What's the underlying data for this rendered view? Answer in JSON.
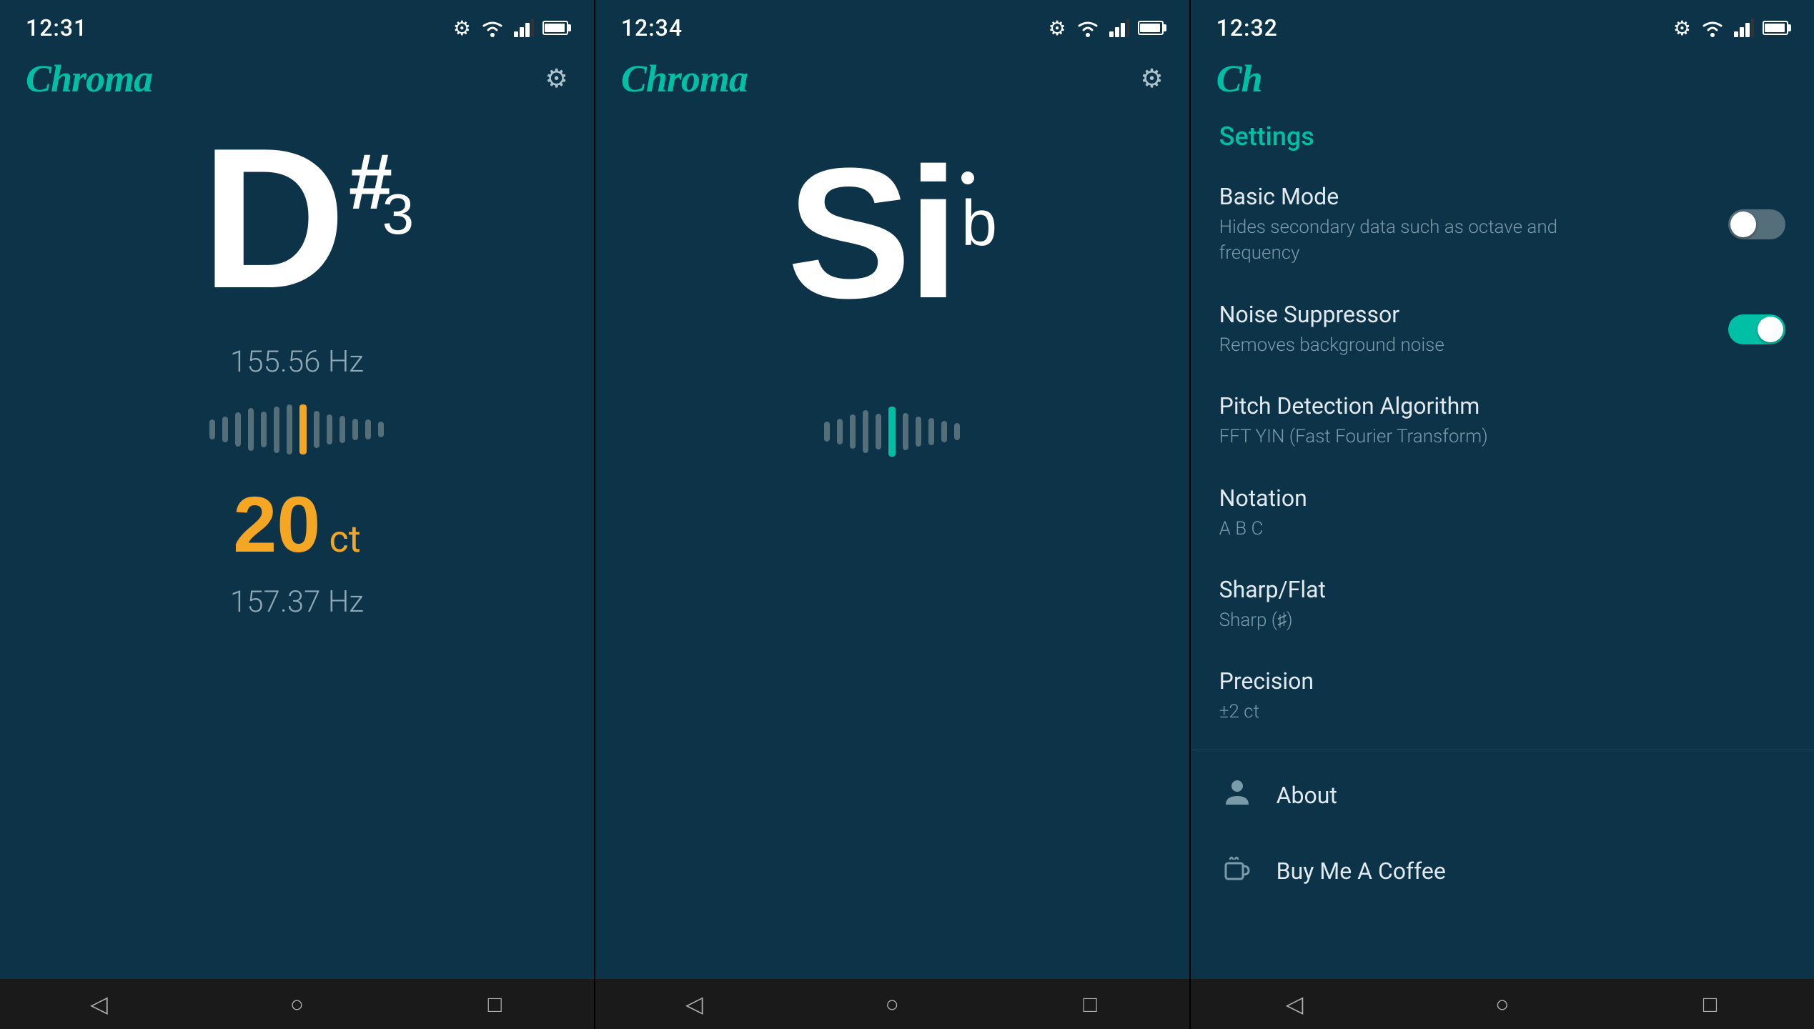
{
  "screen1": {
    "status": {
      "time": "12:31",
      "gear": "⚙"
    },
    "logo": "Chroma",
    "note": "D",
    "accidental": "#",
    "octave": "3",
    "frequency": "155.56 Hz",
    "cents": "20",
    "cents_unit": "ct",
    "actual_freq": "157.37 Hz"
  },
  "screen2": {
    "status": {
      "time": "12:34",
      "gear": "⚙"
    },
    "logo": "Chroma",
    "note": "Si",
    "accidental": "b"
  },
  "screen3": {
    "status": {
      "time": "12:32",
      "gear": "⚙"
    },
    "logo_partial": "Ch",
    "settings_title": "Settings",
    "items": [
      {
        "label": "Basic Mode",
        "desc": "Hides secondary data such as octave and frequency",
        "toggle": false,
        "has_toggle": true
      },
      {
        "label": "Noise Suppressor",
        "desc": "Removes background noise",
        "toggle": true,
        "has_toggle": true
      },
      {
        "label": "Pitch Detection Algorithm",
        "desc": "FFT YIN (Fast Fourier Transform)",
        "toggle": false,
        "has_toggle": false
      },
      {
        "label": "Notation",
        "desc": "A B C",
        "toggle": false,
        "has_toggle": false
      },
      {
        "label": "Sharp/Flat",
        "desc": "Sharp (♯)",
        "toggle": false,
        "has_toggle": false
      },
      {
        "label": "Precision",
        "desc": "±2 ct",
        "toggle": false,
        "has_toggle": false
      }
    ],
    "actions": [
      {
        "icon": "👤",
        "label": "About"
      },
      {
        "icon": "☕",
        "label": "Buy Me A Coffee"
      }
    ]
  },
  "nav": {
    "back": "◁",
    "home": "○",
    "recents": "□"
  }
}
